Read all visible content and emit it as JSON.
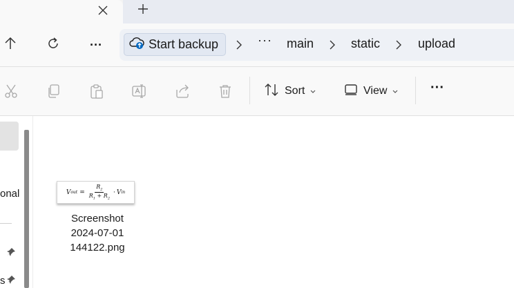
{
  "window": {
    "tab_close_icon": "close-icon",
    "new_tab_icon": "plus-icon"
  },
  "nav": {
    "up_icon": "arrow-up-icon",
    "refresh_icon": "refresh-icon",
    "more_label": "···"
  },
  "address": {
    "backup_label": "Start backup",
    "backup_icon": "cloud-upload-icon",
    "overflow_label": "···",
    "crumbs": [
      "main",
      "static",
      "upload"
    ]
  },
  "toolbar": {
    "cut_icon": "scissors-icon",
    "copy_icon": "copy-icon",
    "paste_icon": "paste-icon",
    "rename_icon": "rename-icon",
    "share_icon": "share-icon",
    "delete_icon": "trash-icon",
    "sort_label": "Sort",
    "view_label": "View",
    "more_label": "···"
  },
  "sidebar": {
    "partial_item_label": "onal",
    "partial_item_2": "s"
  },
  "files": [
    {
      "name_line1": "Screenshot",
      "name_line2": "2024-07-01",
      "name_line3": "144122.png",
      "thumbnail": {
        "lhs": "V",
        "lhs_sub": "out",
        "num": "R",
        "num_sub": "2",
        "den_a": "R",
        "den_a_sub": "1",
        "den_plus": " + ",
        "den_b": "R",
        "den_b_sub": "2",
        "rhs": "V",
        "rhs_sub": "in"
      }
    }
  ],
  "colors": {
    "accent": "#0067c0",
    "window_bg": "#f9f9f9",
    "addressbar_bg": "#eef1f6"
  }
}
